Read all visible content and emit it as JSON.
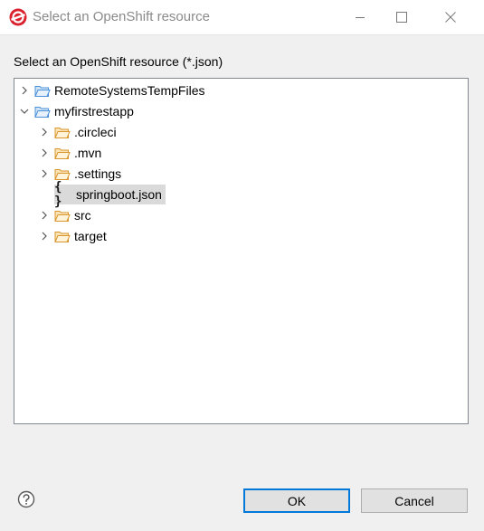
{
  "window": {
    "title": "Select an OpenShift resource"
  },
  "dialog": {
    "prompt": "Select an OpenShift resource (*.json)"
  },
  "tree": {
    "items": [
      {
        "label": "RemoteSystemsTempFiles",
        "kind": "project",
        "expanded": false
      },
      {
        "label": "myfirstrestapp",
        "kind": "project",
        "expanded": true
      },
      {
        "label": ".circleci",
        "kind": "folder",
        "expanded": false
      },
      {
        "label": ".mvn",
        "kind": "folder",
        "expanded": false
      },
      {
        "label": ".settings",
        "kind": "folder",
        "expanded": false
      },
      {
        "label": "springboot.json",
        "kind": "json-file",
        "selected": true
      },
      {
        "label": "src",
        "kind": "folder",
        "expanded": false
      },
      {
        "label": "target",
        "kind": "folder",
        "expanded": false
      }
    ]
  },
  "buttons": {
    "ok": "OK",
    "cancel": "Cancel"
  },
  "colors": {
    "folder": "#e8a33d",
    "project_folder": "#4a90d9",
    "selection": "#dadada",
    "default_button_border": "#0078d7"
  }
}
